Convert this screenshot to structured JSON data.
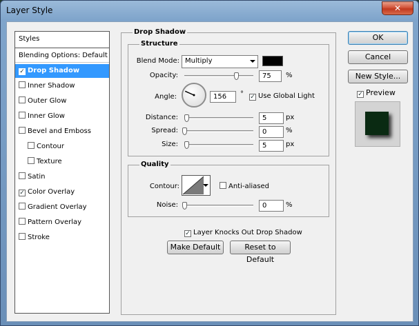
{
  "window": {
    "title": "Layer Style",
    "close_glyph": "✕"
  },
  "styles_panel": {
    "header": "Styles",
    "items": [
      {
        "label": "Blending Options: Default",
        "checkbox": false,
        "checked": false,
        "indent": false
      },
      {
        "label": "Drop Shadow",
        "checkbox": true,
        "checked": true,
        "indent": false,
        "selected": true
      },
      {
        "label": "Inner Shadow",
        "checkbox": true,
        "checked": false,
        "indent": false
      },
      {
        "label": "Outer Glow",
        "checkbox": true,
        "checked": false,
        "indent": false
      },
      {
        "label": "Inner Glow",
        "checkbox": true,
        "checked": false,
        "indent": false
      },
      {
        "label": "Bevel and Emboss",
        "checkbox": true,
        "checked": false,
        "indent": false
      },
      {
        "label": "Contour",
        "checkbox": true,
        "checked": false,
        "indent": true
      },
      {
        "label": "Texture",
        "checkbox": true,
        "checked": false,
        "indent": true
      },
      {
        "label": "Satin",
        "checkbox": true,
        "checked": false,
        "indent": false
      },
      {
        "label": "Color Overlay",
        "checkbox": true,
        "checked": true,
        "indent": false
      },
      {
        "label": "Gradient Overlay",
        "checkbox": true,
        "checked": false,
        "indent": false
      },
      {
        "label": "Pattern Overlay",
        "checkbox": true,
        "checked": false,
        "indent": false
      },
      {
        "label": "Stroke",
        "checkbox": true,
        "checked": false,
        "indent": false
      }
    ]
  },
  "drop_shadow": {
    "title": "Drop Shadow",
    "structure": {
      "title": "Structure",
      "blend_mode_label": "Blend Mode:",
      "blend_mode_value": "Multiply",
      "shadow_color": "#000000",
      "opacity_label": "Opacity:",
      "opacity_value": "75",
      "opacity_level": 0.75,
      "opacity_unit": "%",
      "angle_label": "Angle:",
      "angle_value": "156",
      "angle_degrees": 156,
      "angle_unit": "°",
      "use_global_light_label": "Use Global Light",
      "use_global_light": true,
      "distance_label": "Distance:",
      "distance_value": "5",
      "distance_unit": "px",
      "spread_label": "Spread:",
      "spread_value": "0",
      "spread_unit": "%",
      "size_label": "Size:",
      "size_value": "5",
      "size_unit": "px"
    },
    "quality": {
      "title": "Quality",
      "contour_label": "Contour:",
      "anti_aliased_label": "Anti-aliased",
      "anti_aliased": false,
      "noise_label": "Noise:",
      "noise_value": "0",
      "noise_unit": "%"
    },
    "knockout_label": "Layer Knocks Out Drop Shadow",
    "knockout": true,
    "make_default_label": "Make Default",
    "reset_default_label": "Reset to Default"
  },
  "buttons": {
    "ok": "OK",
    "cancel": "Cancel",
    "new_style": "New Style..."
  },
  "preview": {
    "label": "Preview",
    "checked": true,
    "swatch_color": "#0a2a12"
  },
  "check_glyph": "✓"
}
